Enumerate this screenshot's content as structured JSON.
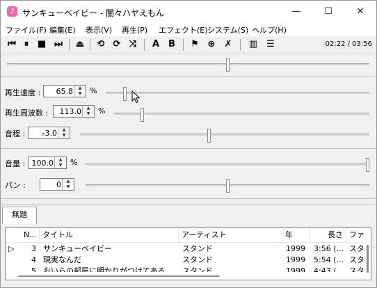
{
  "window": {
    "title": "サンキューベイビー - 闇々ハヤえもん",
    "icon": "hayaemon-app-icon",
    "controls": {
      "minimize": "—",
      "maximize": "☐",
      "close": "✕"
    }
  },
  "menu": [
    {
      "label": "ファイル(F)"
    },
    {
      "label": "編集(E)"
    },
    {
      "label": "表示(V)"
    },
    {
      "label": "再生(P)"
    },
    {
      "label": "エフェクト(E)"
    },
    {
      "label": "システム(S)"
    },
    {
      "label": "ヘルプ(H)"
    }
  ],
  "toolbar": {
    "buttons": [
      {
        "name": "previous-track-icon",
        "glyph": "⏮"
      },
      {
        "name": "pause-icon",
        "glyph": "⏸"
      },
      {
        "name": "stop-icon",
        "glyph": "■"
      },
      {
        "name": "next-track-icon",
        "glyph": "⏭"
      },
      {
        "name": "eject-icon",
        "glyph": "⏏"
      },
      {
        "name": "repeat-one-icon",
        "glyph": "⟲"
      },
      {
        "name": "repeat-all-icon",
        "glyph": "⟳"
      },
      {
        "name": "random-icon",
        "glyph": "⤨"
      },
      {
        "name": "ab-loop-a-icon",
        "glyph": "A"
      },
      {
        "name": "ab-loop-b-icon",
        "glyph": "B"
      },
      {
        "name": "marker-play-icon",
        "glyph": "⚑"
      },
      {
        "name": "add-marker-icon",
        "glyph": "⊕"
      },
      {
        "name": "delete-marker-icon",
        "glyph": "✗"
      },
      {
        "name": "explorer-toggle-icon",
        "glyph": "▥"
      },
      {
        "name": "playlist-toggle-icon",
        "glyph": "☰"
      }
    ],
    "time": "02:22 / 03:56"
  },
  "position_slider": {
    "value": 0.608
  },
  "speed": {
    "label": "再生速度 :",
    "value": "65.8",
    "unit": "%",
    "slider_value": 0.07
  },
  "frequency": {
    "label": "再生周波数 :",
    "value": "113.0",
    "unit": "%",
    "slider_value": 0.11
  },
  "pitch": {
    "label": "音程 :",
    "value": "♭3.0",
    "slider_value": 0.445
  },
  "volume": {
    "label": "音量 :",
    "value": "100.0",
    "unit": "%",
    "slider_value": 1.0
  },
  "pan": {
    "label": "パン :",
    "value": "0",
    "slider_value": 0.5
  },
  "playlist": {
    "tab": "無題",
    "columns": [
      "N...",
      "タイトル",
      "アーティスト",
      "年",
      "長さ",
      "ファ"
    ],
    "rows": [
      {
        "playing": true,
        "marker": "▷",
        "no": "3",
        "title": "サンキューベイビー",
        "artist": "スタンド",
        "year": "1999",
        "length": "3:56 (...",
        "file": "スタ"
      },
      {
        "playing": false,
        "marker": "",
        "no": "4",
        "title": "現実なんだ",
        "artist": "スタンド",
        "year": "1999",
        "length": "5:54 (...",
        "file": "スタ"
      },
      {
        "playing": false,
        "marker": "",
        "no": "5",
        "title": "おいらの部屋に明かりがつけてある",
        "artist": "スタンド",
        "year": "1999",
        "length": "4:43 (...",
        "file": "スタ"
      }
    ]
  }
}
